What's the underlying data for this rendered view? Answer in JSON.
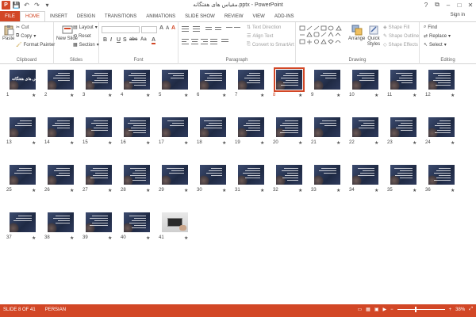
{
  "window": {
    "title": "مقیاس های هفتگانه.pptx - PowerPoint",
    "app_icon_letter": "P",
    "controls": {
      "help": "?",
      "restore": "⧉",
      "minimize": "–",
      "maximize": "□",
      "close": "✕"
    }
  },
  "qat": {
    "save": "💾",
    "undo": "↶",
    "redo": "↷",
    "customize": "▾"
  },
  "tabs": [
    "FILE",
    "HOME",
    "INSERT",
    "DESIGN",
    "TRANSITIONS",
    "ANIMATIONS",
    "SLIDE SHOW",
    "REVIEW",
    "VIEW",
    "ADD-INS"
  ],
  "active_tab": "HOME",
  "signin": "Sign in",
  "ribbon": {
    "clipboard": {
      "label": "Clipboard",
      "paste": "Paste",
      "cut": "Cut",
      "copy": "Copy",
      "format_painter": "Format Painter"
    },
    "slides": {
      "label": "Slides",
      "new_slide": "New Slide",
      "layout": "Layout",
      "reset": "Reset",
      "section": "Section"
    },
    "font": {
      "label": "Font",
      "bold": "B",
      "italic": "I",
      "underline": "U",
      "shadow": "S",
      "strike": "abc",
      "grow": "A",
      "shrink": "A",
      "clear": "A",
      "case": "Aa",
      "color": "A"
    },
    "paragraph": {
      "label": "Paragraph",
      "text_direction": "Text Direction",
      "align_text": "Align Text",
      "convert_smartart": "Convert to SmartArt"
    },
    "drawing": {
      "label": "Drawing",
      "arrange": "Arrange",
      "quick_styles": "Quick Styles",
      "shape_fill": "Shape Fill",
      "shape_outline": "Shape Outline",
      "shape_effects": "Shape Effects"
    },
    "editing": {
      "label": "Editing",
      "find": "Find",
      "replace": "Replace",
      "select": "Select"
    }
  },
  "slides": [
    {
      "n": "1",
      "headline": "مقیاس های هفتگانه"
    },
    {
      "n": "2"
    },
    {
      "n": "3"
    },
    {
      "n": "4"
    },
    {
      "n": "5"
    },
    {
      "n": "6"
    },
    {
      "n": "7"
    },
    {
      "n": "8"
    },
    {
      "n": "9"
    },
    {
      "n": "10"
    },
    {
      "n": "11"
    },
    {
      "n": "12"
    },
    {
      "n": "13"
    },
    {
      "n": "14"
    },
    {
      "n": "15"
    },
    {
      "n": "16"
    },
    {
      "n": "17"
    },
    {
      "n": "18"
    },
    {
      "n": "19"
    },
    {
      "n": "20"
    },
    {
      "n": "21"
    },
    {
      "n": "22"
    },
    {
      "n": "23"
    },
    {
      "n": "24"
    },
    {
      "n": "25"
    },
    {
      "n": "26"
    },
    {
      "n": "27"
    },
    {
      "n": "28"
    },
    {
      "n": "29"
    },
    {
      "n": "30"
    },
    {
      "n": "31"
    },
    {
      "n": "32"
    },
    {
      "n": "33"
    },
    {
      "n": "34"
    },
    {
      "n": "35"
    },
    {
      "n": "36"
    },
    {
      "n": "37"
    },
    {
      "n": "38"
    },
    {
      "n": "39"
    },
    {
      "n": "40"
    },
    {
      "n": "41",
      "photo": true
    }
  ],
  "selected_slide": "8",
  "star_glyph": "★",
  "status": {
    "slide_info": "SLIDE 8 OF 41",
    "language": "PERSIAN",
    "zoom": "38%",
    "zoom_level": 0.38
  },
  "colors": {
    "accent": "#d24726"
  }
}
